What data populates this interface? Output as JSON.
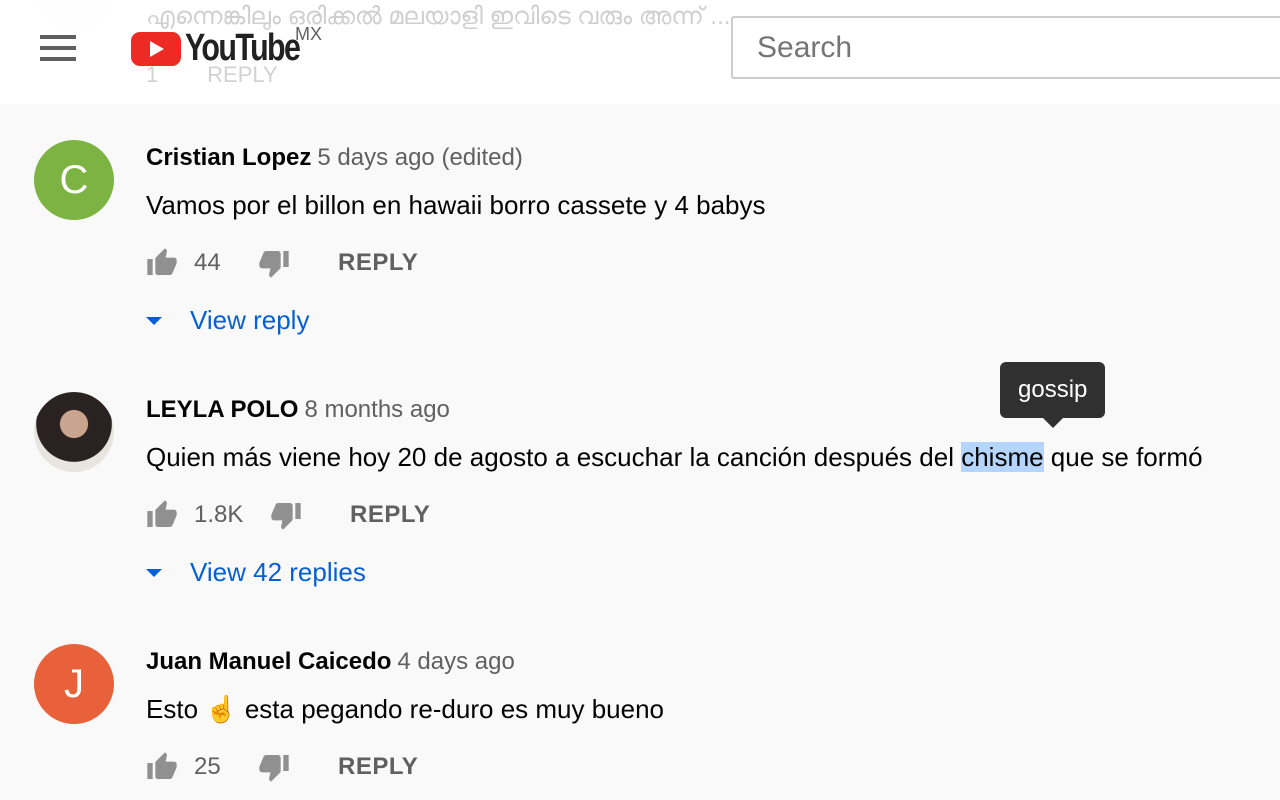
{
  "header": {
    "logo_text": "YouTube",
    "region": "MX",
    "search_placeholder": "Search"
  },
  "ghost_comment": {
    "text": "എന്നെങ്കിലും ഒരിക്കൽ മലയാളി ഇവിടെ വരും അന്ന് ...",
    "likes": "1",
    "reply": "REPLY"
  },
  "tooltip": "gossip",
  "comments": [
    {
      "author": "Cristian Lopez",
      "time": "5 days ago (edited)",
      "text": "Vamos por el billon en hawaii borro cassete y 4 babys",
      "likes": "44",
      "reply": "REPLY",
      "view_replies": "View reply",
      "avatar_letter": "C",
      "avatar_color": "#7cb342"
    },
    {
      "author": "LEYLA POLO",
      "time": "8 months ago",
      "text_before": "Quien más viene hoy 20 de agosto a escuchar la canción después del ",
      "text_highlight": "chisme",
      "text_after": " que se formó",
      "likes": "1.8K",
      "reply": "REPLY",
      "view_replies": "View 42 replies"
    },
    {
      "author": "Juan Manuel Caicedo",
      "time": "4 days ago",
      "text": "Esto ☝ esta pegando re-duro es muy bueno",
      "likes": "25",
      "reply": "REPLY",
      "avatar_letter": "J",
      "avatar_color": "#e8613a"
    }
  ]
}
